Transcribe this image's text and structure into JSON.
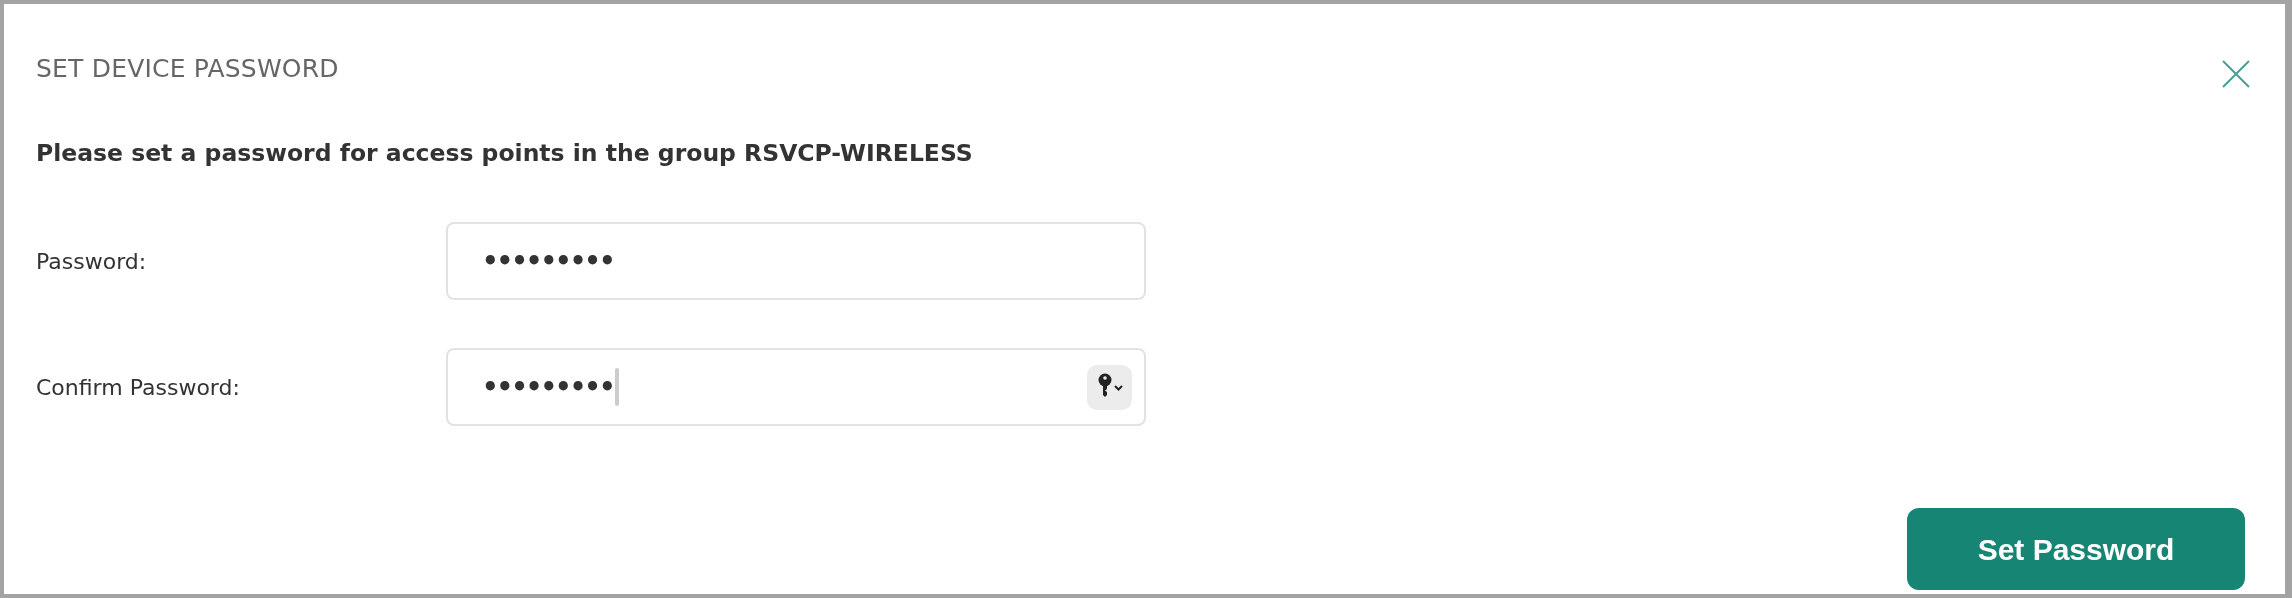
{
  "dialog": {
    "title": "SET DEVICE PASSWORD",
    "message": "Please set a password for access points in the group RSVCP-WIRELESS"
  },
  "fields": [
    {
      "label": "Password:",
      "value": "•••••••••",
      "focused": false,
      "autofill_key": false
    },
    {
      "label": "Confirm Password:",
      "value": "•••••••••",
      "focused": true,
      "autofill_key": true
    }
  ],
  "buttons": [
    {
      "label": "Set Password"
    }
  ]
}
